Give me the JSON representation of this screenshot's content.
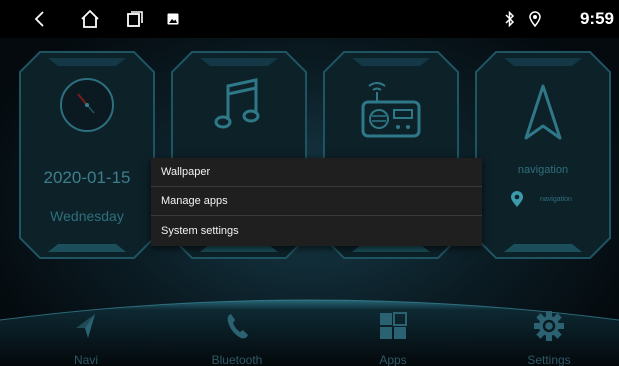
{
  "status_bar": {
    "time": "9:59",
    "icons": [
      "back-icon",
      "home-icon",
      "recent-apps-icon",
      "image-notification-icon",
      "bluetooth-icon",
      "location-icon"
    ]
  },
  "widgets": {
    "clock": {
      "date": "2020-01-15",
      "weekday": "Wednesday",
      "icon": "analog-clock-icon"
    },
    "music": {
      "icon": "music-note-icon"
    },
    "radio": {
      "icon": "radio-icon"
    },
    "navigation": {
      "label": "navigation",
      "sublabel": "navigation",
      "icon": "navigation-arrow-icon"
    }
  },
  "context_menu": {
    "items": [
      {
        "label": "Wallpaper"
      },
      {
        "label": "Manage apps"
      },
      {
        "label": "System settings"
      }
    ]
  },
  "dock": {
    "items": [
      {
        "label": "Navi",
        "icon": "navi-arrow-icon"
      },
      {
        "label": "Bluetooth",
        "icon": "phone-icon"
      },
      {
        "label": "Apps",
        "icon": "apps-grid-icon"
      },
      {
        "label": "Settings",
        "icon": "gear-icon"
      }
    ]
  },
  "colors": {
    "accent": "#2b8a9a",
    "menu_background": "#1f1f1f",
    "status_bar": "#000000"
  }
}
